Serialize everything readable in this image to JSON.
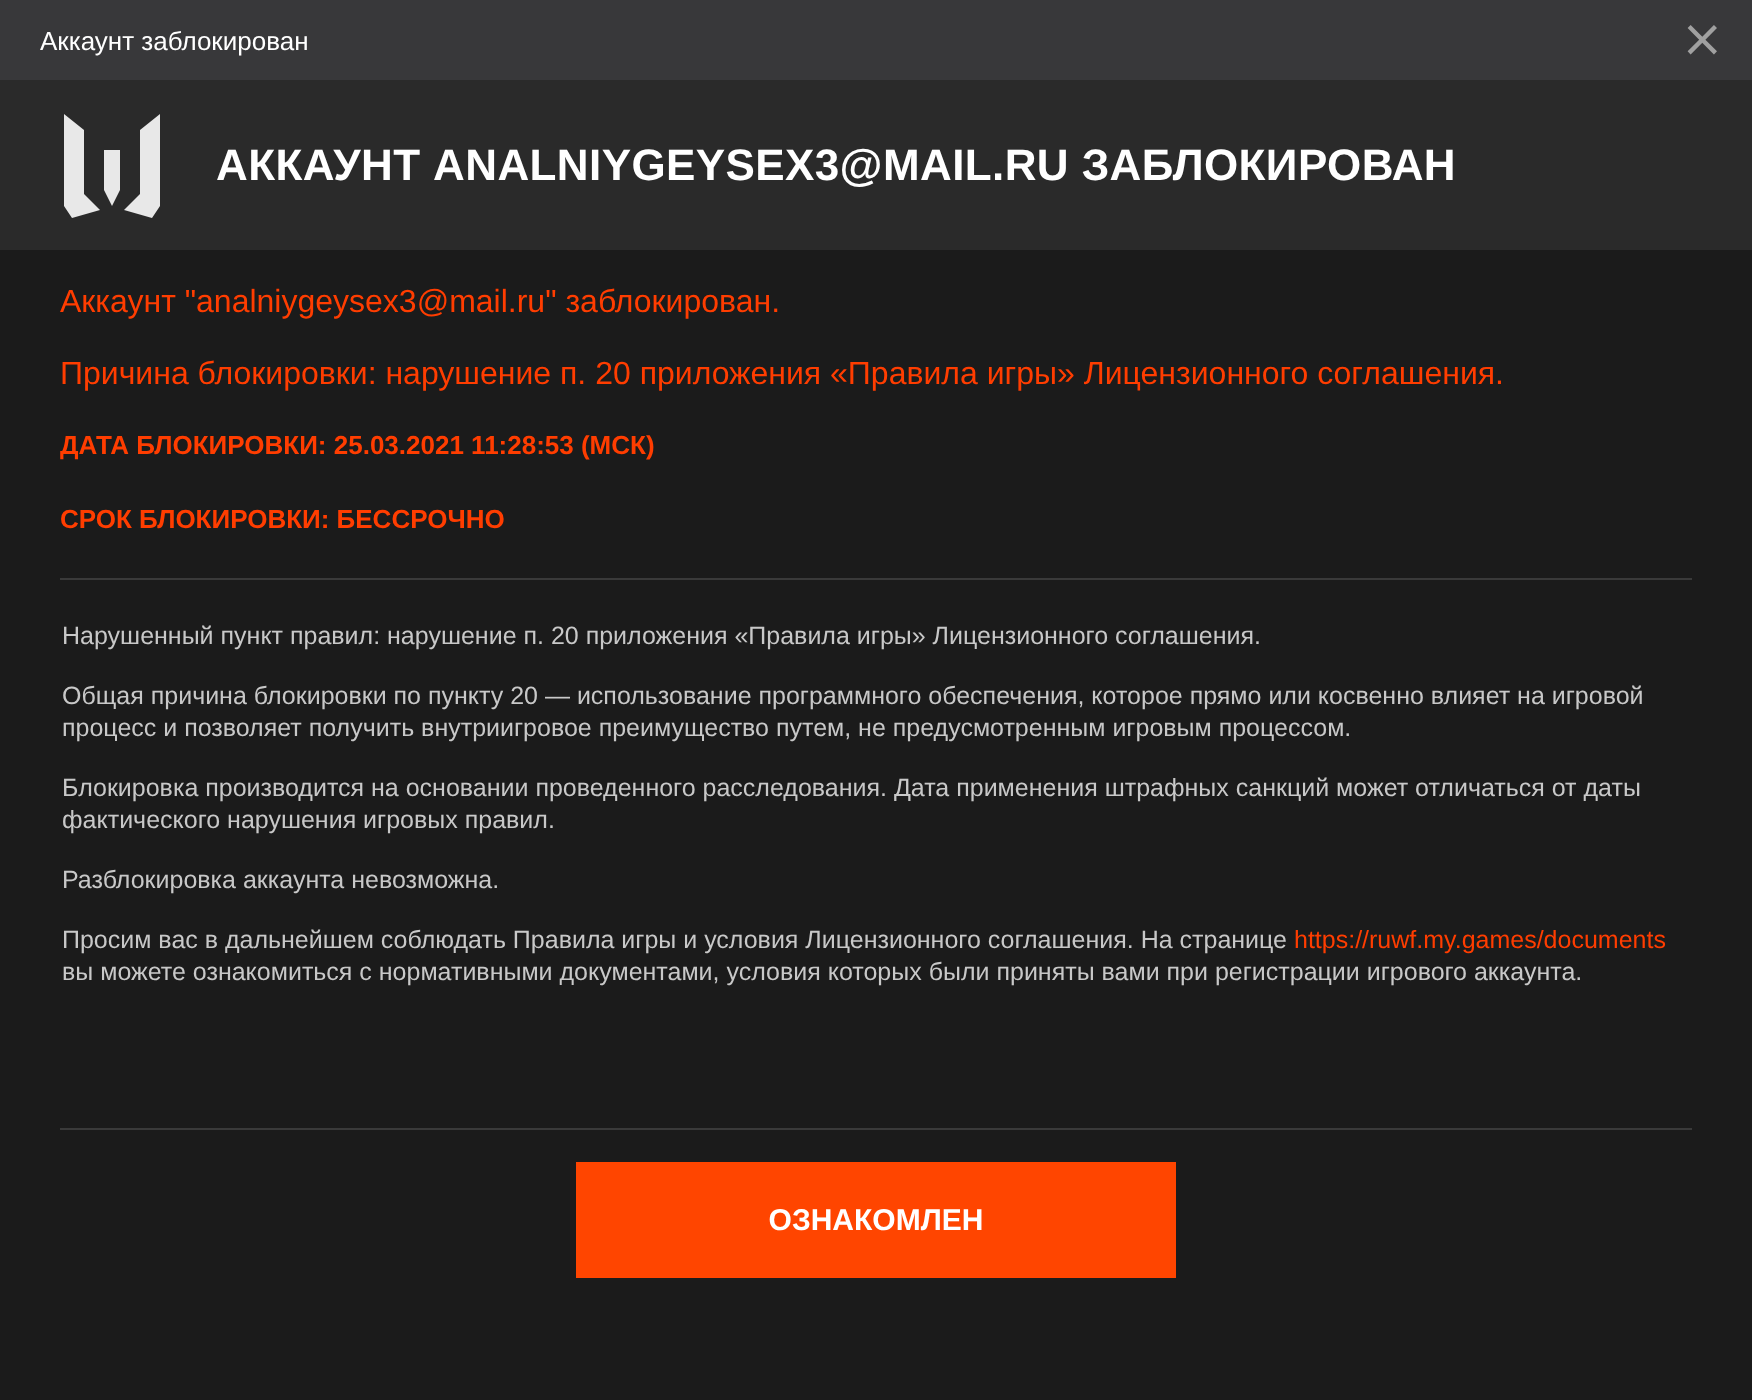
{
  "window": {
    "title": "Аккаунт заблокирован",
    "close": "×"
  },
  "header": {
    "title": "АККАУНТ ANALNIYGEYSEX3@MAIL.RU ЗАБЛОКИРОВАН"
  },
  "notices": [
    {
      "kind": "large",
      "text": "Аккаунт \"analniygeysex3@mail.ru\" заблокирован."
    },
    {
      "kind": "large",
      "text": "Причина блокировки: нарушение п. 20 приложения «Правила игры» Лицензионного соглашения."
    },
    {
      "kind": "caps",
      "text": "ДАТА БЛОКИРОВКИ: 25.03.2021 11:28:53 (МСК)"
    },
    {
      "kind": "caps",
      "text": "СРОК БЛОКИРОВКИ: БЕССРОЧНО"
    }
  ],
  "details": [
    {
      "text": "Нарушенный пункт правил: нарушение п. 20 приложения «Правила игры» Лицензионного соглашения."
    },
    {
      "text": "Общая причина блокировки по пункту 20 — использование программного обеспечения, которое прямо или косвенно влияет на игровой процесс и позволяет получить внутриигровое преимущество путем, не предусмотренным игровым процессом."
    },
    {
      "text": "Блокировка производится на основании проведенного расследования. Дата применения штрафных санкций может отличаться от даты фактического нарушения игровых правил."
    },
    {
      "text": "Разблокировка аккаунта невозможна."
    },
    {
      "text": "Просим вас в дальнейшем соблюдать Правила игры и условия Лицензионного соглашения. На странице",
      "link": "https://ruwf.my.games/documents",
      "after": "вы можете ознакомиться с нормативными документами, условия которых были приняты вами при регистрации игрового аккаунта."
    }
  ],
  "button": {
    "label": "ОЗНАКОМЛЕН"
  }
}
